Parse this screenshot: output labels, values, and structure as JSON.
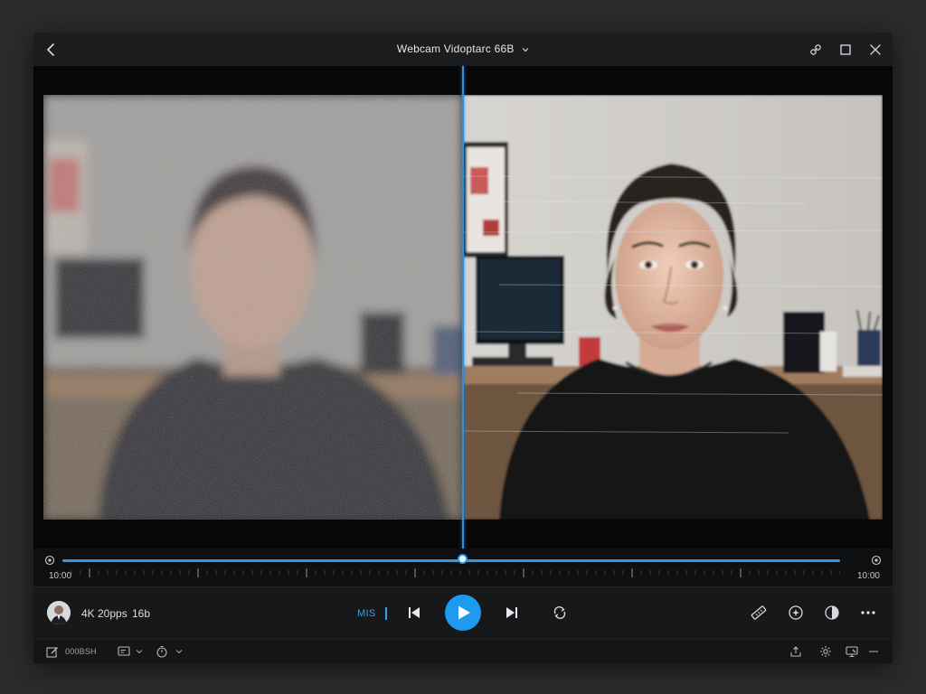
{
  "window": {
    "title": "Webcam Vidoptarc 66B",
    "icons": [
      "back-arrow-icon",
      "chevron-down-icon",
      "link-icon",
      "maximize-icon",
      "close-icon"
    ]
  },
  "timeline": {
    "start_time": "10:00",
    "end_time": "10:00",
    "playhead_fraction": 0.515,
    "fill_fraction": 1.0
  },
  "controls": {
    "resolution": "4K 20pps",
    "bitrate": "16b",
    "mode_label": "MIS",
    "accent_color": "#1e9bf0",
    "icons": [
      "skip-back-icon",
      "play-icon",
      "skip-forward-icon",
      "loop-icon",
      "ruler-icon",
      "sparkle-icon",
      "contrast-icon",
      "more-icon"
    ]
  },
  "statusbar": {
    "label": "000BSH",
    "icons": [
      "edit-icon",
      "caption-icon",
      "timer-icon",
      "share-icon",
      "settings-icon",
      "screen-icon",
      "minimize-icon"
    ]
  }
}
